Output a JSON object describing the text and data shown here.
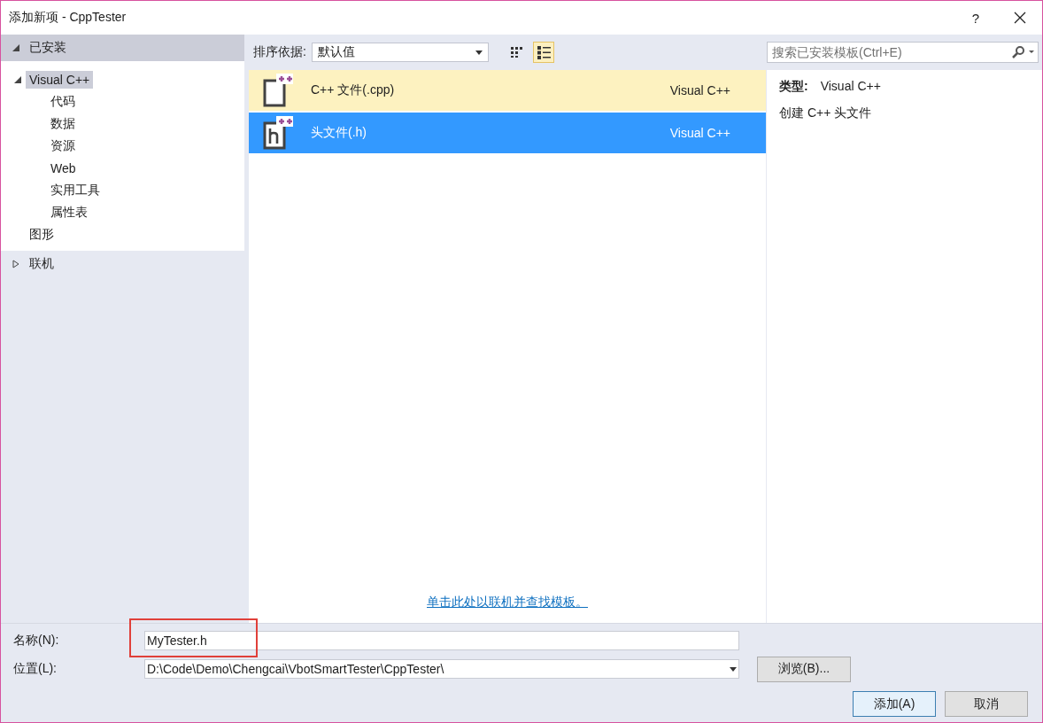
{
  "window": {
    "title": "添加新项 - CppTester",
    "help": "?"
  },
  "sidebar": {
    "sections": [
      {
        "label": "已安装",
        "expanded": true,
        "children": [
          {
            "label": "Visual C++",
            "selected": true,
            "expanded": true,
            "children": [
              {
                "label": "代码",
                "selected": false
              },
              {
                "label": "数据",
                "selected": false
              },
              {
                "label": "资源",
                "selected": false
              },
              {
                "label": "Web",
                "selected": false
              },
              {
                "label": "实用工具",
                "selected": false
              },
              {
                "label": "属性表",
                "selected": false
              }
            ]
          },
          {
            "label": "图形",
            "selected": false
          }
        ]
      },
      {
        "label": "联机",
        "expanded": false
      }
    ]
  },
  "toolbar": {
    "sort_label": "排序依据:",
    "sort_value": "默认值",
    "views": [
      {
        "kind": "grid",
        "selected": false
      },
      {
        "kind": "list",
        "selected": true
      }
    ],
    "search": {
      "placeholder": "搜索已安装模板(Ctrl+E)"
    }
  },
  "templates": [
    {
      "name": "C++ 文件(.cpp)",
      "type": "Visual C++",
      "kind": "cpp",
      "selected": false,
      "hovered": true
    },
    {
      "name": "头文件(.h)",
      "type": "Visual C++",
      "kind": "h",
      "selected": true,
      "hovered": false
    }
  ],
  "details": {
    "type_label": "类型:",
    "type_value": "Visual C++",
    "description": "创建 C++ 头文件"
  },
  "online_link": "单击此处以联机并查找模板。",
  "form": {
    "name_label": "名称(N):",
    "name_value": "MyTester.h",
    "location_label": "位置(L):",
    "location_value": "D:\\Code\\Demo\\Chengcai\\VbotSmartTester\\CppTester\\",
    "browse": "浏览(B)...",
    "add": "添加(A)",
    "cancel": "取消"
  }
}
